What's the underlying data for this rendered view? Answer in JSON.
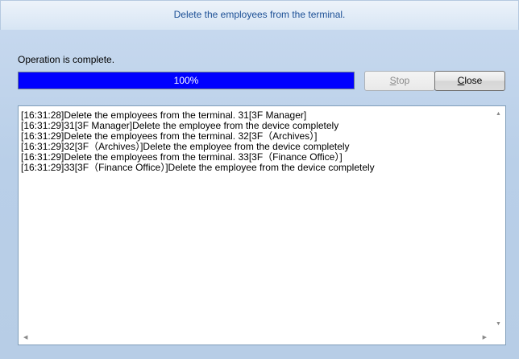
{
  "window": {
    "title": "Delete the employees from the terminal."
  },
  "status": {
    "text": "Operation is complete."
  },
  "progress": {
    "value": 100,
    "label": "100%",
    "fill_color": "#0000ff"
  },
  "buttons": {
    "stop": {
      "mnemonic": "S",
      "rest": "top",
      "enabled": false
    },
    "close": {
      "mnemonic": "C",
      "rest": "lose",
      "enabled": true
    }
  },
  "log": {
    "lines": [
      "[16:31:28]Delete the employees from the terminal. 31[3F Manager]",
      "[16:31:29]31[3F Manager]Delete the employee from the device completely",
      "[16:31:29]Delete the employees from the terminal. 32[3F（Archives）]",
      "[16:31:29]32[3F（Archives）]Delete the employee from the device completely",
      "[16:31:29]Delete the employees from the terminal. 33[3F（Finance Office）]",
      "[16:31:29]33[3F（Finance Office）]Delete the employee from the device completely"
    ]
  },
  "icons": {
    "scroll_up": "chevron-up-icon",
    "scroll_down": "chevron-down-icon",
    "scroll_left": "chevron-left-icon",
    "scroll_right": "chevron-right-icon"
  }
}
